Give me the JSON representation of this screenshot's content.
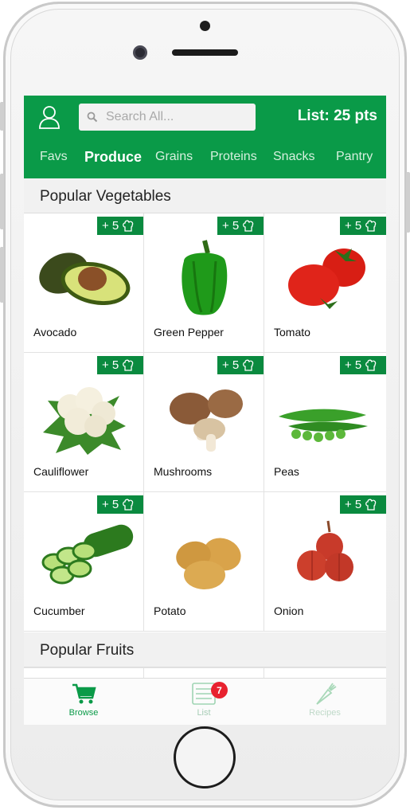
{
  "header": {
    "search_placeholder": "Search All...",
    "list_points": "List: 25 pts"
  },
  "tabs": [
    {
      "label": "Favs",
      "active": false
    },
    {
      "label": "Produce",
      "active": true
    },
    {
      "label": "Grains",
      "active": false
    },
    {
      "label": "Proteins",
      "active": false
    },
    {
      "label": "Snacks",
      "active": false
    },
    {
      "label": "Pantry",
      "active": false
    }
  ],
  "sections": {
    "vegetables_title": "Popular Vegetables",
    "fruits_title": "Popular Fruits"
  },
  "items": [
    {
      "name": "Avocado",
      "badge": "+ 5",
      "icon": "avocado-image"
    },
    {
      "name": "Green Pepper",
      "badge": "+ 5",
      "icon": "green-pepper-image"
    },
    {
      "name": "Tomato",
      "badge": "+ 5",
      "icon": "tomato-image"
    },
    {
      "name": "Cauliflower",
      "badge": "+ 5",
      "icon": "cauliflower-image"
    },
    {
      "name": "Mushrooms",
      "badge": "+ 5",
      "icon": "mushrooms-image"
    },
    {
      "name": "Peas",
      "badge": "+ 5",
      "icon": "peas-image"
    },
    {
      "name": "Cucumber",
      "badge": "+ 5",
      "icon": "cucumber-image"
    },
    {
      "name": "Potato",
      "badge": "",
      "icon": "potato-image"
    },
    {
      "name": "Onion",
      "badge": "+ 5",
      "icon": "onion-image"
    }
  ],
  "tabbar": {
    "browse": "Browse",
    "list": "List",
    "list_count": "7",
    "recipes": "Recipes"
  },
  "colors": {
    "brand_green": "#0a9a48",
    "badge_green": "#0a8a3f",
    "notification_red": "#e8222f"
  }
}
